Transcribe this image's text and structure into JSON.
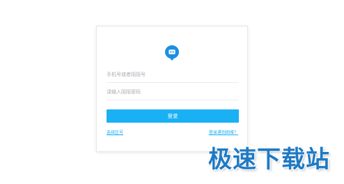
{
  "login": {
    "phone_placeholder": "手机号或者陌陌号",
    "password_placeholder": "请输入陌陌密码",
    "login_button": "登录",
    "switch_account_link": "选择区号",
    "help_link": "登录遇到困难？"
  },
  "watermark": {
    "text": "极速下载站"
  },
  "colors": {
    "accent": "#1ab0f4",
    "logo": "#1a8fe3",
    "watermark": "#1f7ac4"
  },
  "icons": {
    "logo": "chat-bubble-icon"
  }
}
